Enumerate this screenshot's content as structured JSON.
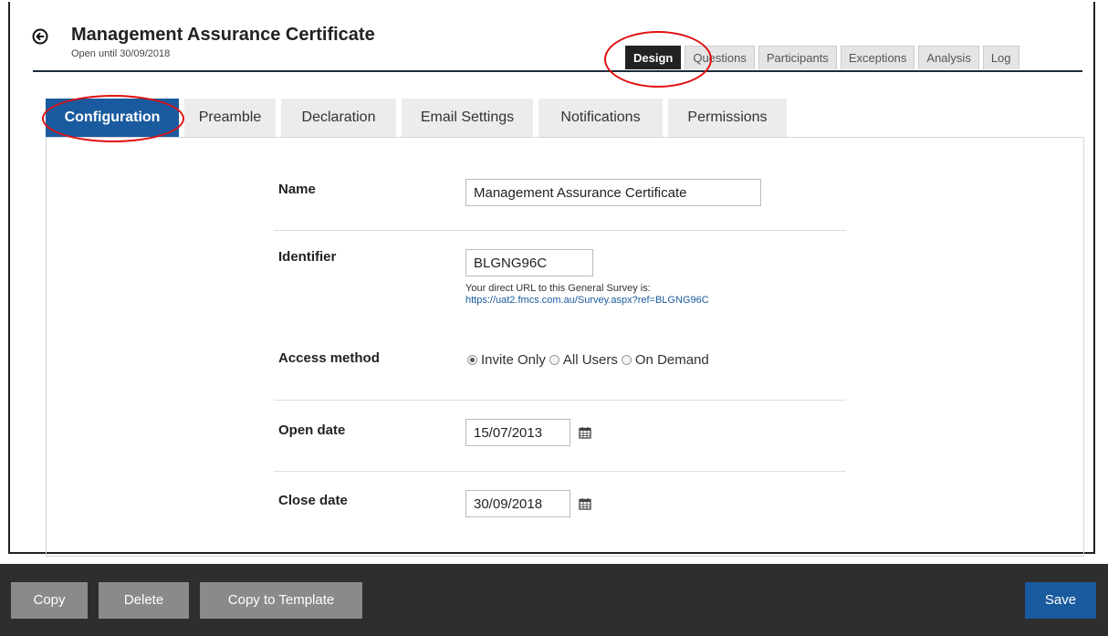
{
  "header": {
    "title": "Management Assurance Certificate",
    "subtitle": "Open until 30/09/2018",
    "back_icon": "circle-arrow-left-icon"
  },
  "top_tabs": [
    {
      "label": "Design",
      "active": true
    },
    {
      "label": "Questions",
      "active": false
    },
    {
      "label": "Participants",
      "active": false
    },
    {
      "label": "Exceptions",
      "active": false
    },
    {
      "label": "Analysis",
      "active": false
    },
    {
      "label": "Log",
      "active": false
    }
  ],
  "sub_tabs": [
    {
      "label": "Configuration",
      "active": true
    },
    {
      "label": "Preamble",
      "active": false
    },
    {
      "label": "Declaration",
      "active": false
    },
    {
      "label": "Email Settings",
      "active": false
    },
    {
      "label": "Notifications",
      "active": false
    },
    {
      "label": "Permissions",
      "active": false
    }
  ],
  "form": {
    "name_label": "Name",
    "name_value": "Management Assurance Certificate",
    "identifier_label": "Identifier",
    "identifier_value": "BLGNG96C",
    "identifier_help": "Your direct URL to this General Survey is:",
    "identifier_url": "https://uat2.fmcs.com.au/Survey.aspx?ref=BLGNG96C",
    "access_label": "Access method",
    "access_options": [
      {
        "label": "Invite Only",
        "checked": true
      },
      {
        "label": "All Users",
        "checked": false
      },
      {
        "label": "On Demand",
        "checked": false
      }
    ],
    "open_label": "Open date",
    "open_value": "15/07/2013",
    "close_label": "Close date",
    "close_value": "30/09/2018",
    "calendar_icon": "calendar-icon"
  },
  "footer": {
    "copy_label": "Copy",
    "delete_label": "Delete",
    "copy_template_label": "Copy to Template",
    "save_label": "Save"
  },
  "colors": {
    "accent": "#1a5a9e",
    "highlight": "#e01010",
    "footer_bg": "#2e2e2e",
    "footer_button": "#8a8a8a",
    "active_top_tab": "#222222"
  }
}
